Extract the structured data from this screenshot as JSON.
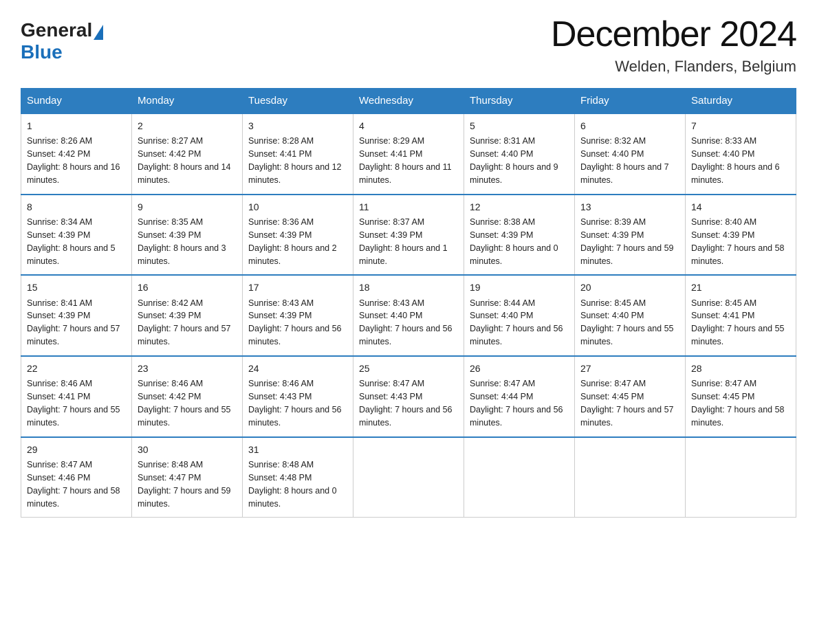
{
  "header": {
    "logo_general": "General",
    "logo_blue": "Blue",
    "month_title": "December 2024",
    "location": "Welden, Flanders, Belgium"
  },
  "weekdays": [
    "Sunday",
    "Monday",
    "Tuesday",
    "Wednesday",
    "Thursday",
    "Friday",
    "Saturday"
  ],
  "weeks": [
    [
      {
        "day": "1",
        "sunrise": "8:26 AM",
        "sunset": "4:42 PM",
        "daylight": "8 hours and 16 minutes."
      },
      {
        "day": "2",
        "sunrise": "8:27 AM",
        "sunset": "4:42 PM",
        "daylight": "8 hours and 14 minutes."
      },
      {
        "day": "3",
        "sunrise": "8:28 AM",
        "sunset": "4:41 PM",
        "daylight": "8 hours and 12 minutes."
      },
      {
        "day": "4",
        "sunrise": "8:29 AM",
        "sunset": "4:41 PM",
        "daylight": "8 hours and 11 minutes."
      },
      {
        "day": "5",
        "sunrise": "8:31 AM",
        "sunset": "4:40 PM",
        "daylight": "8 hours and 9 minutes."
      },
      {
        "day": "6",
        "sunrise": "8:32 AM",
        "sunset": "4:40 PM",
        "daylight": "8 hours and 7 minutes."
      },
      {
        "day": "7",
        "sunrise": "8:33 AM",
        "sunset": "4:40 PM",
        "daylight": "8 hours and 6 minutes."
      }
    ],
    [
      {
        "day": "8",
        "sunrise": "8:34 AM",
        "sunset": "4:39 PM",
        "daylight": "8 hours and 5 minutes."
      },
      {
        "day": "9",
        "sunrise": "8:35 AM",
        "sunset": "4:39 PM",
        "daylight": "8 hours and 3 minutes."
      },
      {
        "day": "10",
        "sunrise": "8:36 AM",
        "sunset": "4:39 PM",
        "daylight": "8 hours and 2 minutes."
      },
      {
        "day": "11",
        "sunrise": "8:37 AM",
        "sunset": "4:39 PM",
        "daylight": "8 hours and 1 minute."
      },
      {
        "day": "12",
        "sunrise": "8:38 AM",
        "sunset": "4:39 PM",
        "daylight": "8 hours and 0 minutes."
      },
      {
        "day": "13",
        "sunrise": "8:39 AM",
        "sunset": "4:39 PM",
        "daylight": "7 hours and 59 minutes."
      },
      {
        "day": "14",
        "sunrise": "8:40 AM",
        "sunset": "4:39 PM",
        "daylight": "7 hours and 58 minutes."
      }
    ],
    [
      {
        "day": "15",
        "sunrise": "8:41 AM",
        "sunset": "4:39 PM",
        "daylight": "7 hours and 57 minutes."
      },
      {
        "day": "16",
        "sunrise": "8:42 AM",
        "sunset": "4:39 PM",
        "daylight": "7 hours and 57 minutes."
      },
      {
        "day": "17",
        "sunrise": "8:43 AM",
        "sunset": "4:39 PM",
        "daylight": "7 hours and 56 minutes."
      },
      {
        "day": "18",
        "sunrise": "8:43 AM",
        "sunset": "4:40 PM",
        "daylight": "7 hours and 56 minutes."
      },
      {
        "day": "19",
        "sunrise": "8:44 AM",
        "sunset": "4:40 PM",
        "daylight": "7 hours and 56 minutes."
      },
      {
        "day": "20",
        "sunrise": "8:45 AM",
        "sunset": "4:40 PM",
        "daylight": "7 hours and 55 minutes."
      },
      {
        "day": "21",
        "sunrise": "8:45 AM",
        "sunset": "4:41 PM",
        "daylight": "7 hours and 55 minutes."
      }
    ],
    [
      {
        "day": "22",
        "sunrise": "8:46 AM",
        "sunset": "4:41 PM",
        "daylight": "7 hours and 55 minutes."
      },
      {
        "day": "23",
        "sunrise": "8:46 AM",
        "sunset": "4:42 PM",
        "daylight": "7 hours and 55 minutes."
      },
      {
        "day": "24",
        "sunrise": "8:46 AM",
        "sunset": "4:43 PM",
        "daylight": "7 hours and 56 minutes."
      },
      {
        "day": "25",
        "sunrise": "8:47 AM",
        "sunset": "4:43 PM",
        "daylight": "7 hours and 56 minutes."
      },
      {
        "day": "26",
        "sunrise": "8:47 AM",
        "sunset": "4:44 PM",
        "daylight": "7 hours and 56 minutes."
      },
      {
        "day": "27",
        "sunrise": "8:47 AM",
        "sunset": "4:45 PM",
        "daylight": "7 hours and 57 minutes."
      },
      {
        "day": "28",
        "sunrise": "8:47 AM",
        "sunset": "4:45 PM",
        "daylight": "7 hours and 58 minutes."
      }
    ],
    [
      {
        "day": "29",
        "sunrise": "8:47 AM",
        "sunset": "4:46 PM",
        "daylight": "7 hours and 58 minutes."
      },
      {
        "day": "30",
        "sunrise": "8:48 AM",
        "sunset": "4:47 PM",
        "daylight": "7 hours and 59 minutes."
      },
      {
        "day": "31",
        "sunrise": "8:48 AM",
        "sunset": "4:48 PM",
        "daylight": "8 hours and 0 minutes."
      },
      null,
      null,
      null,
      null
    ]
  ],
  "labels": {
    "sunrise": "Sunrise:",
    "sunset": "Sunset:",
    "daylight": "Daylight:"
  }
}
